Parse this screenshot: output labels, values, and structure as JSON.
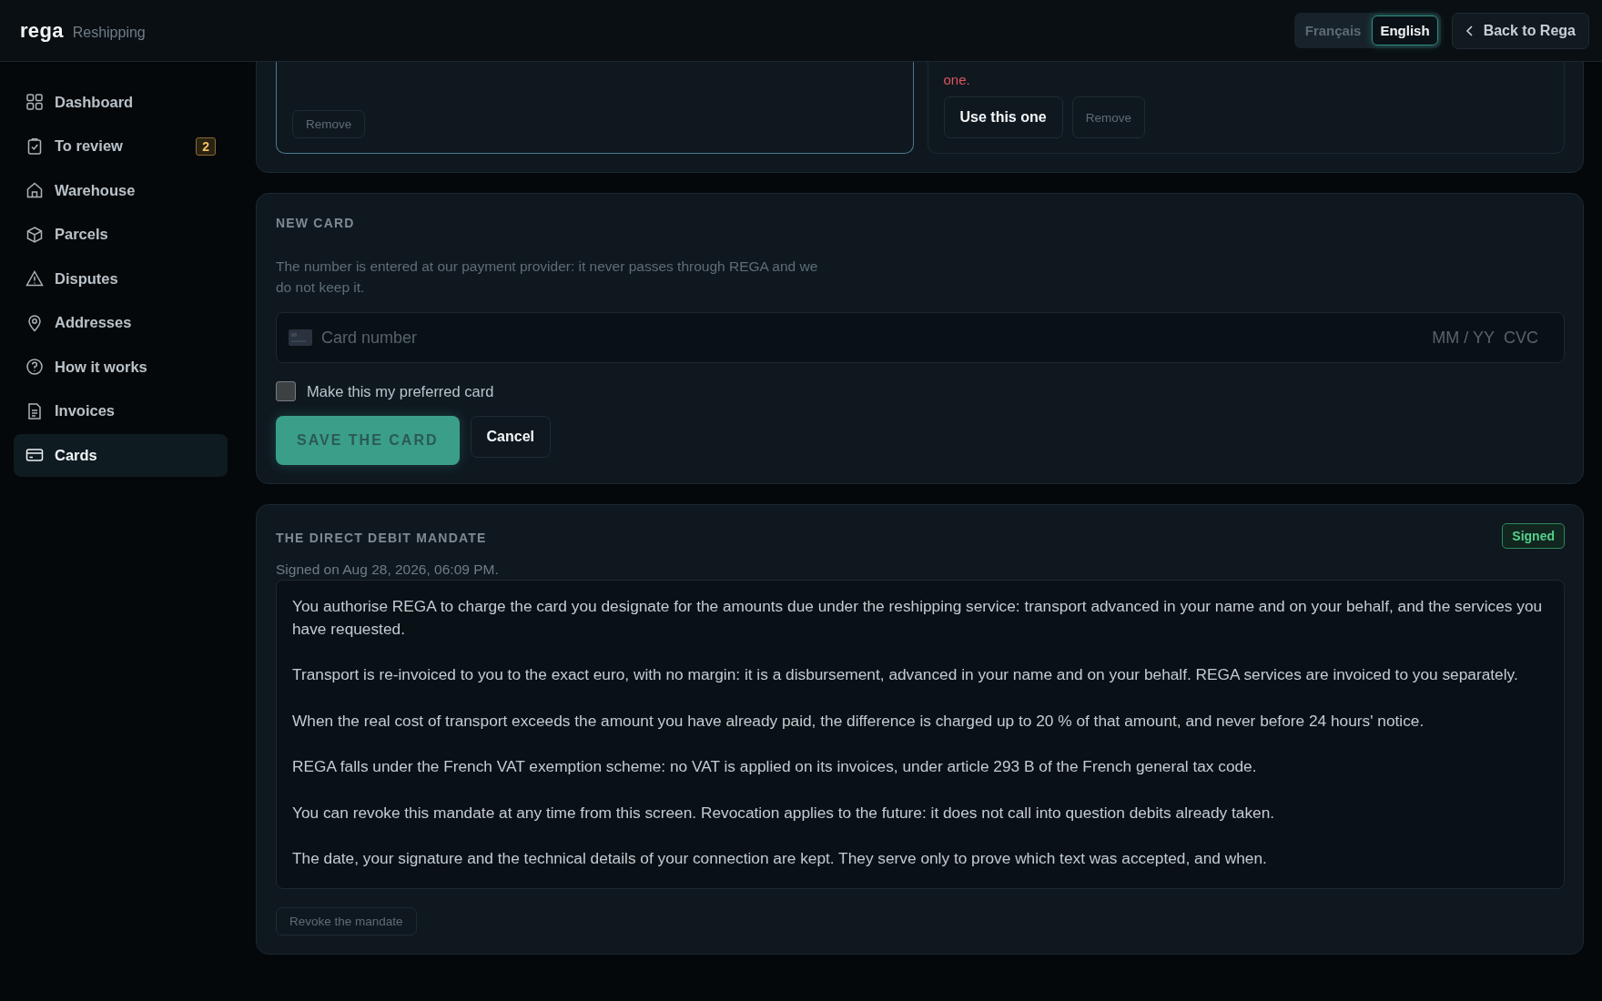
{
  "header": {
    "logo": "rega",
    "subtitle": "Reshipping",
    "languages": [
      {
        "label": "Français",
        "selected": false
      },
      {
        "label": "English",
        "selected": true
      }
    ],
    "back_button": "Back to Rega"
  },
  "sidebar": {
    "items": [
      {
        "label": "Dashboard",
        "selected": false
      },
      {
        "label": "To review",
        "selected": false,
        "badge": "2"
      },
      {
        "label": "Warehouse",
        "selected": false
      },
      {
        "label": "Parcels",
        "selected": false
      },
      {
        "label": "Disputes",
        "selected": false
      },
      {
        "label": "Addresses",
        "selected": false
      },
      {
        "label": "How it works",
        "selected": false
      },
      {
        "label": "Invoices",
        "selected": false
      },
      {
        "label": "Cards",
        "selected": true
      }
    ]
  },
  "saved_cards": [
    {
      "selected": true,
      "buttons": [
        {
          "label": "Remove",
          "kind": "secondary"
        }
      ]
    },
    {
      "selected": false,
      "error": "one.",
      "buttons": [
        {
          "label": "Use this one",
          "kind": "primary"
        },
        {
          "label": "Remove",
          "kind": "secondary"
        }
      ]
    }
  ],
  "new_card": {
    "title": "NEW CARD",
    "description": "The number is entered at our payment provider: it never passes through REGA and we do not keep it.",
    "card_field": {
      "placeholder": "Card number",
      "expiry_placeholder": "MM / YY",
      "cvc_placeholder": "CVC"
    },
    "preferred": {
      "label": "Make this my preferred card",
      "checked": false
    },
    "save_button": {
      "label": "SAVE THE CARD",
      "disabled": true
    },
    "cancel_button": "Cancel"
  },
  "mandate": {
    "title": "THE DIRECT DEBIT MANDATE",
    "status": "Signed",
    "signed_on": "Signed on Aug 28, 2026, 06:09 PM.",
    "paragraphs": [
      "You authorise REGA to charge the card you designate for the amounts due under the reshipping service: transport advanced in your name and on your behalf, and the services you have requested.",
      "Transport is re-invoiced to you to the exact euro, with no margin: it is a disbursement, advanced in your name and on your behalf. REGA services are invoiced to you separately.",
      "When the real cost of transport exceeds the amount you have already paid, the difference is charged up to 20 % of that amount, and never before 24 hours' notice.",
      "REGA falls under the French VAT exemption scheme: no VAT is applied on its invoices, under article 293 B of the French general tax code.",
      "You can revoke this mandate at any time from this screen. Revocation applies to the future: it does not call into question debits already taken.",
      "The date, your signature and the technical details of your connection are kept. They serve only to prove which text was accepted, and when."
    ],
    "revoke_button": "Revoke the mandate"
  }
}
